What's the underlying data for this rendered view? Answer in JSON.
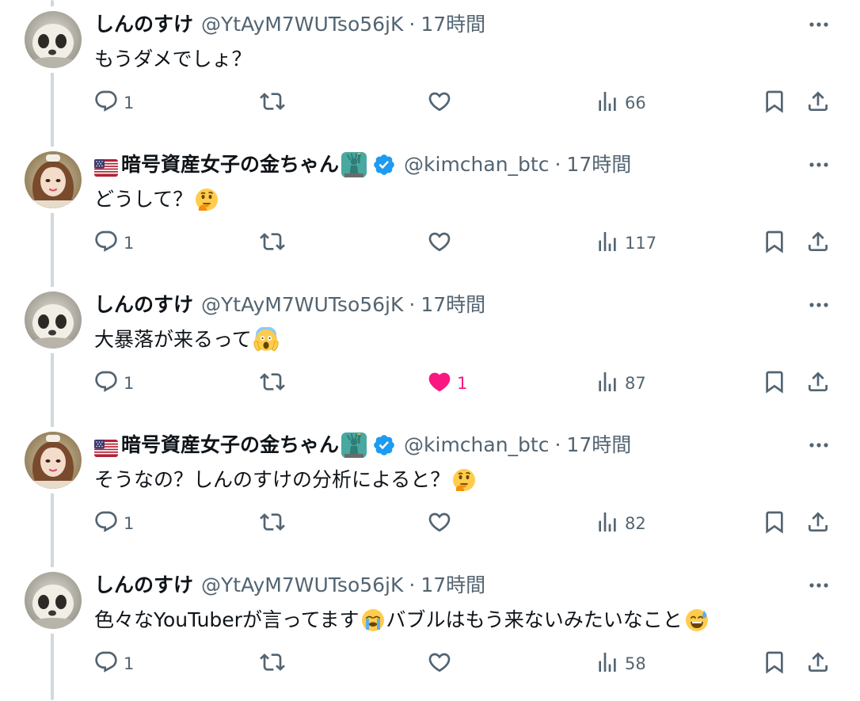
{
  "tweets": [
    {
      "display_name": "しんのすけ",
      "handle": "@YtAyM7WUTso56jK",
      "dot": "·",
      "time": "17時間",
      "text": "もうダメでしょ？",
      "emoji_after": "",
      "text2": "",
      "emoji_end": "",
      "replies": "1",
      "retweets": "",
      "likes": "",
      "liked": false,
      "views": "66",
      "avatar": "shinnosuke"
    },
    {
      "display_name": "暗号資産女子の金ちゃん",
      "handle": "@kimchan_btc",
      "dot": "·",
      "time": "17時間",
      "text": "どうして？",
      "emoji_after": "thinking-face",
      "text2": "",
      "emoji_end": "",
      "replies": "1",
      "retweets": "",
      "likes": "",
      "liked": false,
      "views": "117",
      "avatar": "kimchan"
    },
    {
      "display_name": "しんのすけ",
      "handle": "@YtAyM7WUTso56jK",
      "dot": "·",
      "time": "17時間",
      "text": "大暴落が来るって",
      "emoji_after": "screaming-face",
      "text2": "",
      "emoji_end": "",
      "replies": "1",
      "retweets": "",
      "likes": "1",
      "liked": true,
      "views": "87",
      "avatar": "shinnosuke"
    },
    {
      "display_name": "暗号資産女子の金ちゃん",
      "handle": "@kimchan_btc",
      "dot": "·",
      "time": "17時間",
      "text": "そうなの？しんのすけの分析によると？",
      "emoji_after": "thinking-face",
      "text2": "",
      "emoji_end": "",
      "replies": "1",
      "retweets": "",
      "likes": "",
      "liked": false,
      "views": "82",
      "avatar": "kimchan"
    },
    {
      "display_name": "しんのすけ",
      "handle": "@YtAyM7WUTso56jK",
      "dot": "·",
      "time": "17時間",
      "text": "色々なYouTuberが言ってます",
      "emoji_after": "crying-face",
      "text2": "バブルはもう来ないみたいなこと",
      "emoji_end": "sweat-smile-face",
      "replies": "1",
      "retweets": "",
      "likes": "",
      "liked": false,
      "views": "58",
      "avatar": "shinnosuke"
    }
  ],
  "colors": {
    "text": "#0f1419",
    "secondary": "#536471",
    "thread_line": "#cfd9de",
    "verified": "#1d9bf0",
    "like_active": "#f91880"
  },
  "icons": {
    "reply": "reply-icon",
    "retweet": "retweet-icon",
    "like": "heart-icon",
    "views": "views-icon",
    "bookmark": "bookmark-icon",
    "share": "share-icon",
    "more": "more-icon",
    "verified": "verified-badge-icon"
  }
}
